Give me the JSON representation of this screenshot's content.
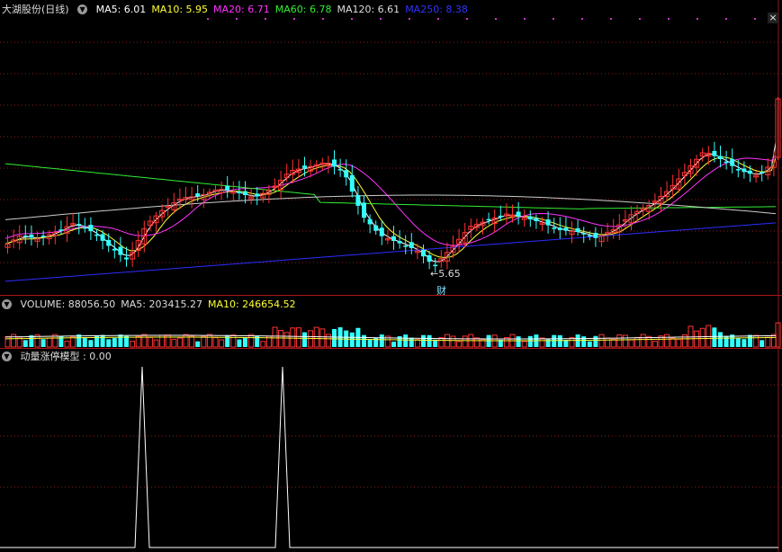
{
  "main": {
    "stock_name": "大湖股份(日线)",
    "ma": [
      {
        "label": "MA5: 6.01",
        "color": "#ffffff"
      },
      {
        "label": "MA10: 5.95",
        "color": "#ffff33"
      },
      {
        "label": "MA20: 6.71",
        "color": "#ff33ff"
      },
      {
        "label": "MA60: 6.78",
        "color": "#33ee33"
      },
      {
        "label": "MA120: 6.61",
        "color": "#dddddd"
      },
      {
        "label": "MA250: 8.38",
        "color": "#3333ff"
      }
    ],
    "low_marker": "5.65",
    "finance_marker": "财",
    "close_glyph": "×",
    "colors": {
      "up": "#ff3333",
      "down": "#33ffff",
      "grid": "#8a1b1b",
      "ma250": "#2d2dff"
    }
  },
  "volume": {
    "labels": [
      {
        "label": "VOLUME: 88056.50",
        "color": "#dddddd"
      },
      {
        "label": "MA5: 203415.27",
        "color": "#dddddd"
      },
      {
        "label": "MA10: 246654.52",
        "color": "#ffff33"
      }
    ]
  },
  "indicator": {
    "label": "动量涨停模型 : 0.00",
    "color": "#ffffff"
  }
}
